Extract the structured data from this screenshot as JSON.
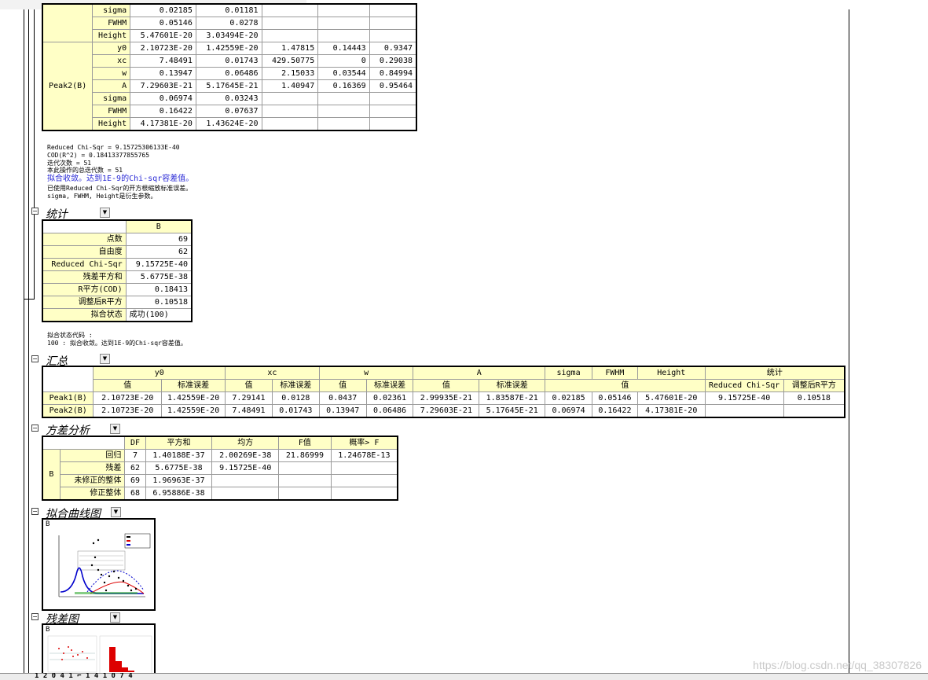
{
  "peak_table": {
    "rows": [
      {
        "group": "",
        "param": "sigma",
        "val": "0.02185",
        "err": "0.01181",
        "t": "",
        "p": "",
        "dep": ""
      },
      {
        "group": "",
        "param": "FWHM",
        "val": "0.05146",
        "err": "0.0278",
        "t": "",
        "p": "",
        "dep": ""
      },
      {
        "group": "",
        "param": "Height",
        "val": "5.47601E-20",
        "err": "3.03494E-20",
        "t": "",
        "p": "",
        "dep": ""
      },
      {
        "group": "Peak2(B)",
        "param": "y0",
        "val": "2.10723E-20",
        "err": "1.42559E-20",
        "t": "1.47815",
        "p": "0.14443",
        "dep": "0.9347"
      },
      {
        "group": "",
        "param": "xc",
        "val": "7.48491",
        "err": "0.01743",
        "t": "429.50775",
        "p": "0",
        "dep": "0.29038"
      },
      {
        "group": "",
        "param": "w",
        "val": "0.13947",
        "err": "0.06486",
        "t": "2.15033",
        "p": "0.03544",
        "dep": "0.84994"
      },
      {
        "group": "",
        "param": "A",
        "val": "7.29603E-21",
        "err": "5.17645E-21",
        "t": "1.40947",
        "p": "0.16369",
        "dep": "0.95464"
      },
      {
        "group": "",
        "param": "sigma",
        "val": "0.06974",
        "err": "0.03243",
        "t": "",
        "p": "",
        "dep": ""
      },
      {
        "group": "",
        "param": "FWHM",
        "val": "0.16422",
        "err": "0.07637",
        "t": "",
        "p": "",
        "dep": ""
      },
      {
        "group": "",
        "param": "Height",
        "val": "4.17381E-20",
        "err": "1.43624E-20",
        "t": "",
        "p": "",
        "dep": ""
      }
    ]
  },
  "fit_notes": {
    "line1": "Reduced Chi-Sqr = 9.15725306133E-40",
    "line2": "COD(R^2) = 0.18413377855765",
    "line3": "迭代次数 = 51",
    "line4": "本此操作的总迭代数 = 51",
    "line5_blue": "拟合收敛。达到1E-9的Chi-sqr容差值。",
    "line6": "已使用Reduced Chi-Sqr的开方根缩放标准误差。",
    "line7": "sigma, FWHM, Height是衍生参数。"
  },
  "stats_section": {
    "title": "统计",
    "col_header": "B",
    "rows": [
      {
        "label": "点数",
        "value": "69"
      },
      {
        "label": "自由度",
        "value": "62"
      },
      {
        "label": "Reduced Chi-Sqr",
        "value": "9.15725E-40"
      },
      {
        "label": "残差平方和",
        "value": "5.6775E-38"
      },
      {
        "label": "R平方(COD)",
        "value": "0.18413"
      },
      {
        "label": "调整后R平方",
        "value": "0.10518"
      },
      {
        "label": "拟合状态",
        "value": "成功(100)"
      }
    ],
    "code_note1": "拟合状态代码 :",
    "code_note2": "100 : 拟合收敛。达到1E-9的Chi-sqr容差值。"
  },
  "summary_section": {
    "title": "汇总",
    "groups": [
      "y0",
      "xc",
      "w",
      "A",
      "sigma",
      "FWHM",
      "Height",
      "统计"
    ],
    "sub": {
      "val": "值",
      "err": "标准误差",
      "chi": "Reduced Chi-Sqr",
      "adjr": "调整后R平方"
    },
    "rows": [
      {
        "name": "Peak1(B)",
        "cells": [
          "2.10723E-20",
          "1.42559E-20",
          "7.29141",
          "0.0128",
          "0.0437",
          "0.02361",
          "2.99935E-21",
          "1.83587E-21",
          "0.02185",
          "0.05146",
          "5.47601E-20",
          "9.15725E-40",
          "0.10518"
        ]
      },
      {
        "name": "Peak2(B)",
        "cells": [
          "2.10723E-20",
          "1.42559E-20",
          "7.48491",
          "0.01743",
          "0.13947",
          "0.06486",
          "7.29603E-21",
          "5.17645E-21",
          "0.06974",
          "0.16422",
          "4.17381E-20",
          "",
          ""
        ]
      }
    ]
  },
  "anova_section": {
    "title": "方差分析",
    "headers": [
      "DF",
      "平方和",
      "均方",
      "F值",
      "概率> F"
    ],
    "group": "B",
    "rows": [
      {
        "label": "回归",
        "df": "7",
        "ss": "1.40188E-37",
        "ms": "2.00269E-38",
        "f": "21.86999",
        "p": "1.24678E-13"
      },
      {
        "label": "残差",
        "df": "62",
        "ss": "5.6775E-38",
        "ms": "9.15725E-40",
        "f": "",
        "p": ""
      },
      {
        "label": "未修正的整体",
        "df": "69",
        "ss": "1.96963E-37",
        "ms": "",
        "f": "",
        "p": ""
      },
      {
        "label": "修正整体",
        "df": "68",
        "ss": "6.95886E-38",
        "ms": "",
        "f": "",
        "p": ""
      }
    ]
  },
  "fit_curve_section": {
    "title": "拟合曲线图",
    "graph_label": "B"
  },
  "residual_section": {
    "title": "残差图",
    "graph_label": "B"
  },
  "tab_label": "1 2 0 4 1 ⌐ 1 4 1 0 7 4",
  "watermark": "https://blog.csdn.net/qq_38307826",
  "icons": {
    "collapse": "minus-box-icon",
    "dropdown": "triangle-down-icon"
  }
}
